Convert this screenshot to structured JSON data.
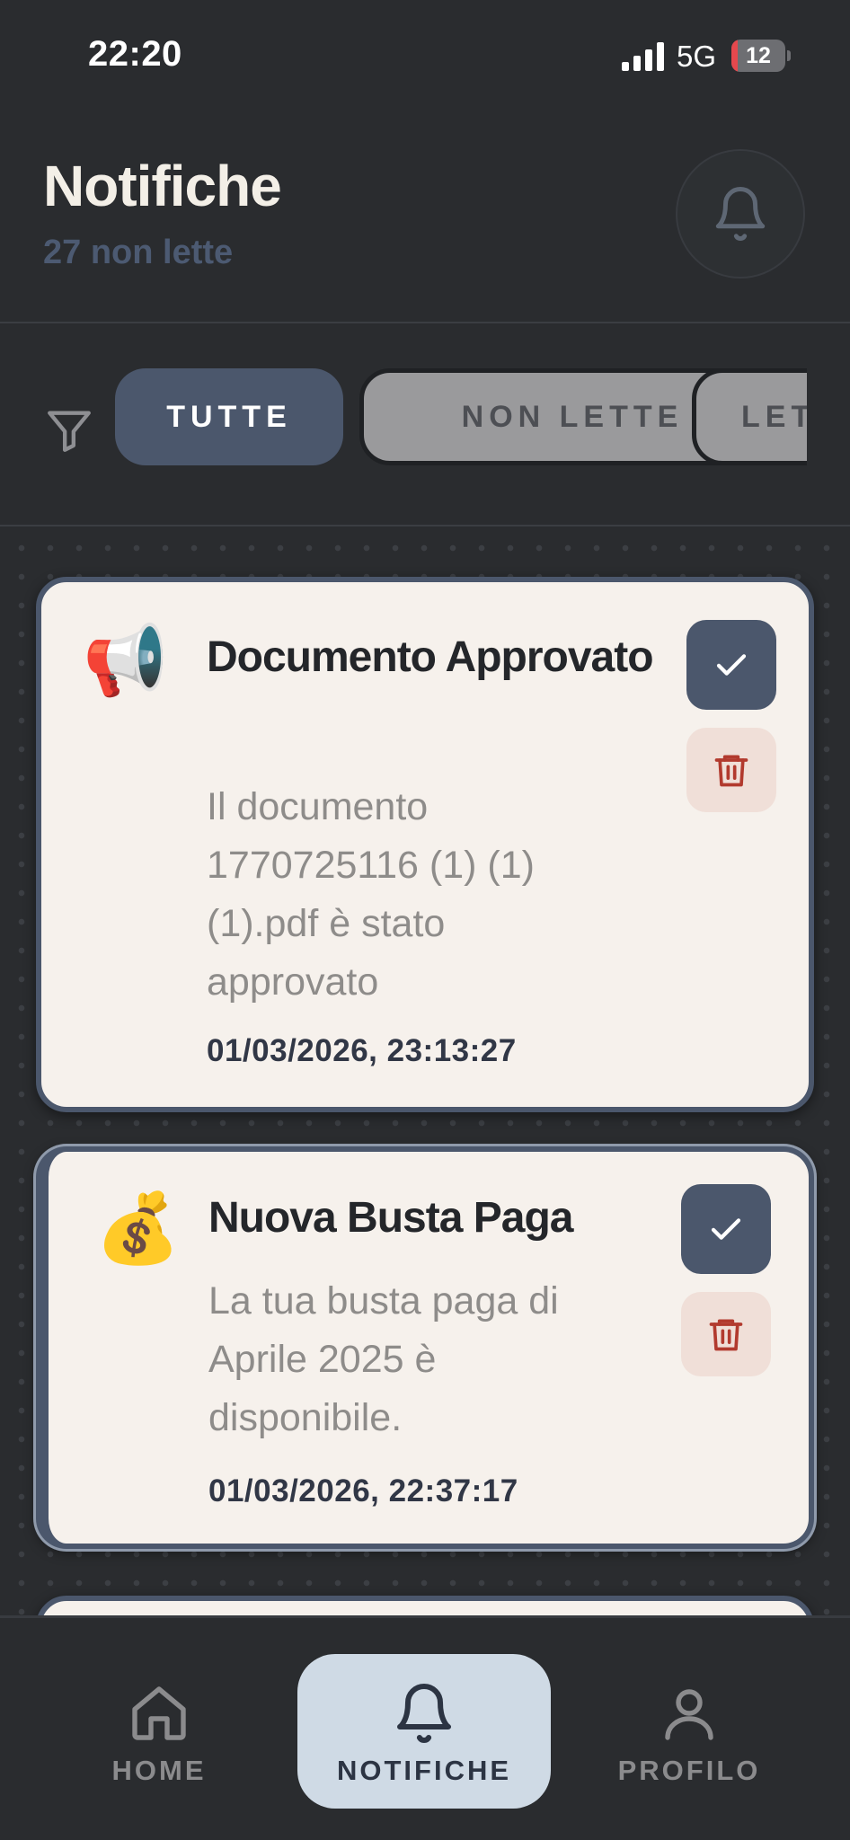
{
  "status_bar": {
    "time": "22:20",
    "network": "5G",
    "battery_level": "12",
    "battery_fraction": 0.12
  },
  "header": {
    "title": "Notifiche",
    "unread_count": "27 non lette",
    "bell_icon": "bell-icon"
  },
  "filters": {
    "icon": "filter-icon",
    "chips": [
      {
        "label": "TUTTE",
        "active": true
      },
      {
        "label": "NON LETTE",
        "active": false
      },
      {
        "label": "LETTE",
        "active": false
      }
    ]
  },
  "notifications": [
    {
      "icon": "📢",
      "icon_name": "megaphone-icon",
      "title": "Documento Approvato",
      "message": "Il documento 1770725116 (1) (1) (1).pdf è stato approvato",
      "timestamp": "01/03/2026, 23:13:27"
    },
    {
      "icon": "💰",
      "icon_name": "money-bag-icon",
      "title": "Nuova Busta Paga",
      "message": "La tua busta paga di Aprile 2025 è disponibile.",
      "timestamp": "01/03/2026, 22:37:17"
    }
  ],
  "actions": {
    "mark_read_icon": "checkmark-icon",
    "delete_icon": "trash-icon"
  },
  "bottom_nav": {
    "items": [
      {
        "label": "HOME",
        "icon": "home-icon",
        "active": false
      },
      {
        "label": "NOTIFICHE",
        "icon": "bell-icon",
        "active": true
      },
      {
        "label": "PROFILO",
        "icon": "user-icon",
        "active": false
      }
    ]
  },
  "colors": {
    "background": "#2a2c2f",
    "accent": "#4b576c",
    "card": "#f6f1ec",
    "delete_bg": "#f0dfd8",
    "delete_icon": "#b23a2e",
    "battery_low": "#e5484d",
    "active_nav": "#cfdae5"
  }
}
